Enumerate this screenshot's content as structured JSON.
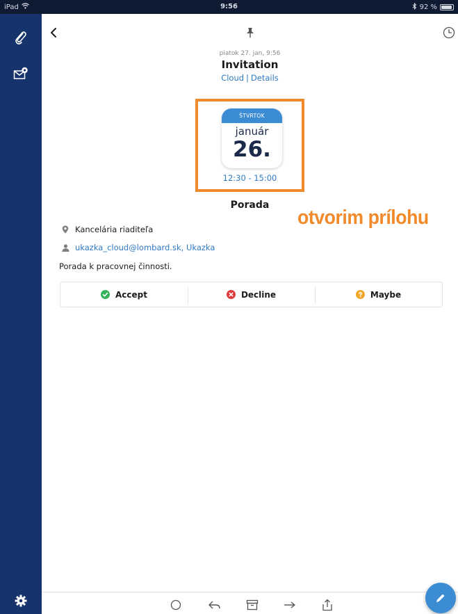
{
  "statusbar": {
    "device": "iPad",
    "time": "9:56",
    "battery": "92 %",
    "battery_level": 0.92
  },
  "sidebar": {
    "icons": [
      "paperclip-icon",
      "mail-settings-icon",
      "gear-icon"
    ]
  },
  "header": {
    "icons": [
      "back-chevron-icon",
      "pin-icon",
      "clock-icon"
    ]
  },
  "message": {
    "date": "piatok 27. jan, 9:56",
    "subject": "Invitation",
    "link_cloud": "Cloud",
    "link_separator": "|",
    "link_details": "Details"
  },
  "calendar": {
    "weekday": "ŠTVRTOK",
    "month": "január",
    "day": "26.",
    "time_range": "12:30 - 15:00"
  },
  "event": {
    "title": "Porada",
    "location": "Kancelária riaditeľa",
    "attendees": "ukazka_cloud@lombard.sk, Ukazka",
    "description": "Porada k pracovnej činnosti."
  },
  "annotation": "otvorim prílohu",
  "actions": {
    "accept": "Accept",
    "decline": "Decline",
    "maybe": "Maybe"
  },
  "colors": {
    "accent": "#3c8cd4",
    "link": "#2f78c4",
    "sidebar": "#16336b",
    "highlight": "#f08a2a",
    "accept": "#35b35a",
    "decline": "#e03a3a",
    "maybe": "#f2a62c"
  },
  "toolbar": {
    "icons": [
      "circle-icon",
      "reply-icon",
      "archive-icon",
      "forward-icon",
      "share-icon"
    ]
  }
}
